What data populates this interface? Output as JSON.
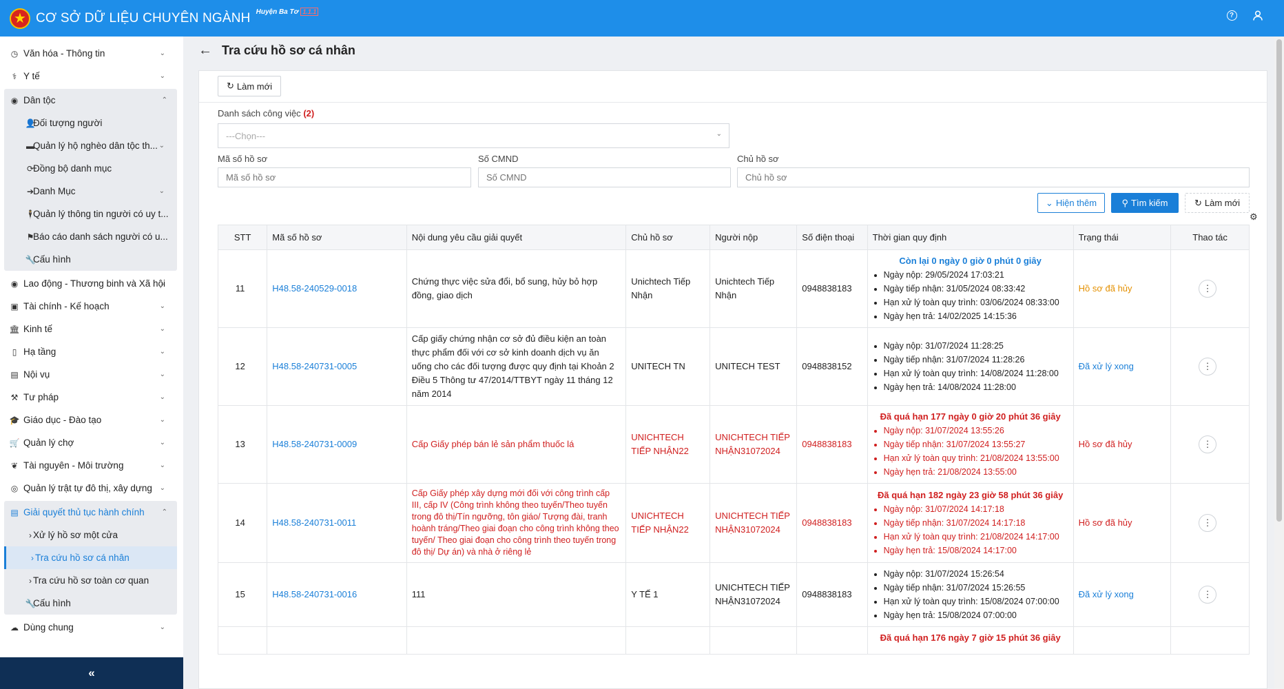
{
  "header": {
    "title": "CƠ SỞ DỮ LIỆU CHUYÊN NGÀNH",
    "district": "Huyện Ba Tơ",
    "district_tag": "1.1.1"
  },
  "sidebar": {
    "items": [
      {
        "label": "Văn hóa - Thông tin",
        "icon": "clock-icon"
      },
      {
        "label": "Y tế",
        "icon": "stethoscope-icon"
      }
    ],
    "group_dantoc": {
      "label": "Dân tộc",
      "subs": [
        {
          "label": "Đối tượng người"
        },
        {
          "label": "Quản lý hộ nghèo dân tộc th..."
        },
        {
          "label": "Đồng bộ danh mục"
        },
        {
          "label": "Danh Mục"
        },
        {
          "label": "Quản lý thông tin người có uy t..."
        },
        {
          "label": "Báo cáo danh sách người có u..."
        },
        {
          "label": "Cấu hình"
        }
      ]
    },
    "items2": [
      {
        "label": "Lao động - Thương binh và Xã hội"
      },
      {
        "label": "Tài chính - Kế hoạch"
      },
      {
        "label": "Kinh tế"
      },
      {
        "label": "Hạ tầng"
      },
      {
        "label": "Nội vụ"
      },
      {
        "label": "Tư pháp"
      },
      {
        "label": "Giáo dục - Đào tạo"
      },
      {
        "label": "Quản lý chợ"
      },
      {
        "label": "Tài nguyên - Môi trường"
      },
      {
        "label": "Quản lý trật tự đô thị, xây dựng"
      }
    ],
    "group_tthc": {
      "label": "Giải quyết thủ tục hành chính",
      "subs": [
        {
          "label": "Xử lý hồ sơ một cửa"
        },
        {
          "label": "Tra cứu hồ sơ cá nhân"
        },
        {
          "label": "Tra cứu hồ sơ toàn cơ quan"
        },
        {
          "label": "Cấu hình"
        }
      ]
    },
    "common": {
      "label": "Dùng chung"
    },
    "collapse": "«"
  },
  "page": {
    "back": "←",
    "title": "Tra cứu hồ sơ cá nhân",
    "refresh_top": "Làm mới"
  },
  "filters": {
    "work_list_label": "Danh sách công việc",
    "work_list_count": "(2)",
    "work_list_placeholder": "---Chọn---",
    "code_label": "Mã số hồ sơ",
    "code_placeholder": "Mã số hồ sơ",
    "id_label": "Số CMND",
    "id_placeholder": "Số CMND",
    "owner_label": "Chủ hồ sơ",
    "owner_placeholder": "Chủ hồ sơ",
    "show_more": "Hiện thêm",
    "search": "Tìm kiếm",
    "reset": "Làm mới"
  },
  "table": {
    "headers": [
      "STT",
      "Mã số hồ sơ",
      "Nội dung yêu cầu giải quyết",
      "Chủ hồ sơ",
      "Người nộp",
      "Số điện thoại",
      "Thời gian quy định",
      "Trạng thái",
      "Thao tác"
    ],
    "rows": [
      {
        "stt": "11",
        "code": "H48.58-240529-0018",
        "content": "Chứng thực việc sửa đổi, bổ sung, hủy bỏ hợp đồng, giao dịch",
        "owner": "Unichtech Tiếp Nhận",
        "submitter": "Unichtech Tiếp Nhận",
        "phone": "0948838183",
        "time_head": "Còn lại 0 ngày 0 giờ 0 phút 0 giây",
        "times": [
          "Ngày nộp: 29/05/2024 17:03:21",
          "Ngày tiếp nhận: 31/05/2024 08:33:42",
          "Hạn xử lý toàn quy trình: 03/06/2024 08:33:00",
          "Ngày hẹn trả: 14/02/2025 14:15:36"
        ],
        "status": "Hồ sơ đã hủy"
      },
      {
        "stt": "12",
        "code": "H48.58-240731-0005",
        "content": "Cấp giấy chứng nhận cơ sở đủ điều kiện an toàn thực phẩm đối với cơ sở kinh doanh dịch vụ ăn uống cho các đối tượng được quy định tại Khoản 2 Điều 5 Thông tư 47/2014/TTBYT ngày 11 tháng 12 năm 2014",
        "owner": "UNITECH TN",
        "submitter": "UNITECH TEST",
        "phone": "0948838152",
        "times": [
          "Ngày nộp: 31/07/2024 11:28:25",
          "Ngày tiếp nhận: 31/07/2024 11:28:26",
          "Hạn xử lý toàn quy trình: 14/08/2024 11:28:00",
          "Ngày hẹn trả: 14/08/2024 11:28:00"
        ],
        "status": "Đã xử lý xong"
      },
      {
        "stt": "13",
        "code": "H48.58-240731-0009",
        "content": "Cấp Giấy phép bán lẻ sản phẩm thuốc lá",
        "owner": "UNICHTECH TIẾP NHẬN22",
        "submitter": "UNICHTECH TIẾP NHẬN31072024",
        "phone": "0948838183",
        "time_head": "Đã quá hạn 177 ngày 0 giờ 20 phút 36 giây",
        "times": [
          "Ngày nộp: 31/07/2024 13:55:26",
          "Ngày tiếp nhận: 31/07/2024 13:55:27",
          "Hạn xử lý toàn quy trình: 21/08/2024 13:55:00",
          "Ngày hẹn trả: 21/08/2024 13:55:00"
        ],
        "status": "Hồ sơ đã hủy"
      },
      {
        "stt": "14",
        "code": "H48.58-240731-0011",
        "content": "Cấp Giấy phép xây dựng mới đối với công trình cấp III, cấp IV (Công trình không theo tuyến/Theo tuyến trong đô thị/Tín ngưỡng, tôn giáo/ Tượng đài, tranh hoành tráng/Theo giai đoạn cho công trình không theo tuyến/ Theo giai đoạn cho công trình theo tuyến trong đô thị/ Dự án) và nhà ở riêng lẻ",
        "owner": "UNICHTECH TIẾP NHẬN22",
        "submitter": "UNICHTECH TIẾP NHẬN31072024",
        "phone": "0948838183",
        "time_head": "Đã quá hạn 182 ngày 23 giờ 58 phút 36 giây",
        "times": [
          "Ngày nộp: 31/07/2024 14:17:18",
          "Ngày tiếp nhận: 31/07/2024 14:17:18",
          "Hạn xử lý toàn quy trình: 21/08/2024 14:17:00",
          "Ngày hẹn trả: 15/08/2024 14:17:00"
        ],
        "status": "Hồ sơ đã hủy"
      },
      {
        "stt": "15",
        "code": "H48.58-240731-0016",
        "content": "111",
        "owner": "Y TẾ 1",
        "submitter": "UNICHTECH TIẾP NHẬN31072024",
        "phone": "0948838183",
        "times": [
          "Ngày nộp: 31/07/2024 15:26:54",
          "Ngày tiếp nhận: 31/07/2024 15:26:55",
          "Hạn xử lý toàn quy trình: 15/08/2024 07:00:00",
          "Ngày hẹn trả: 15/08/2024 07:00:00"
        ],
        "status": "Đã xử lý xong"
      },
      {
        "time_head": "Đã quá hạn 176 ngày 7 giờ 15 phút 36 giây"
      }
    ]
  },
  "colors": {
    "header_bg": "#1e8ee9",
    "link": "#1a7fd8",
    "overdue": "#d01f1f",
    "cancelled": "#e49000"
  }
}
